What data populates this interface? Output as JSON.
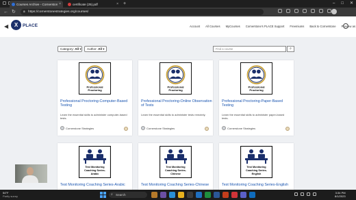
{
  "browser": {
    "tabs": [
      {
        "title": "Courses Archive - Cornerstone S",
        "active": true,
        "favicon_color": "#2f6fd6"
      },
      {
        "title": "certificate (25).pdf",
        "active": false,
        "favicon_color": "#d33c3c"
      }
    ],
    "new_tab_glyph": "+",
    "window_controls": [
      "–",
      "□",
      "✕"
    ],
    "url": "https://cornerstonestrategies.org/courses/"
  },
  "site": {
    "logo_text": "PLACE",
    "logo_glyph": "X",
    "nav": [
      "Account",
      "All Courses",
      "MyCourses",
      "Cornerstone's PLACE Support",
      "Freemiums",
      "Back to Cornerstone",
      "Preview as"
    ],
    "nav_caret": "▾"
  },
  "filters": {
    "category_label": "Category:",
    "category_value": "All",
    "author_label": "Author:",
    "author_value": "All",
    "search_placeholder": "Find a course"
  },
  "courses": [
    {
      "title": "Professional Proctoring-Computer-Based Testing",
      "description": "Learn the essential skills to administer computer-based tests.",
      "author": "Cornerstone Strategies",
      "image_caption": "Professional Proctoring"
    },
    {
      "title": "Professional Proctoring-Online Observation of Tests",
      "description": "Learn the essential skills to administer tests remotely.",
      "author": "Cornerstone Strategies",
      "image_caption": "Professional Proctoring"
    },
    {
      "title": "Professional Proctoring-Paper-Based Testing",
      "description": "Learn the essential skills to administer paper-based tests.",
      "author": "Cornerstone Strategies",
      "image_caption": "Professional Proctoring"
    },
    {
      "title": "Test Monitoring Coaching Series-Arabic",
      "image_caption": "Test Monitoring Coaching Series- Arabic"
    },
    {
      "title": "Test Monitoring Coaching Series-Chinese",
      "image_caption": "Test Monitoring Coaching Series- Chinese"
    },
    {
      "title": "Test Monitoring Coaching Series-English",
      "image_caption": "Test Monitoring Coaching Series- English"
    }
  ],
  "taskbar": {
    "temperature": "54°F",
    "condition": "Partly sunny",
    "search_label": "Search",
    "time": "3:34 PM",
    "date": "8/1/2023"
  },
  "colors": {
    "brand_navy": "#1b2f6b",
    "link_blue": "#1a55b0",
    "ring_gold": "#c9a23a"
  }
}
